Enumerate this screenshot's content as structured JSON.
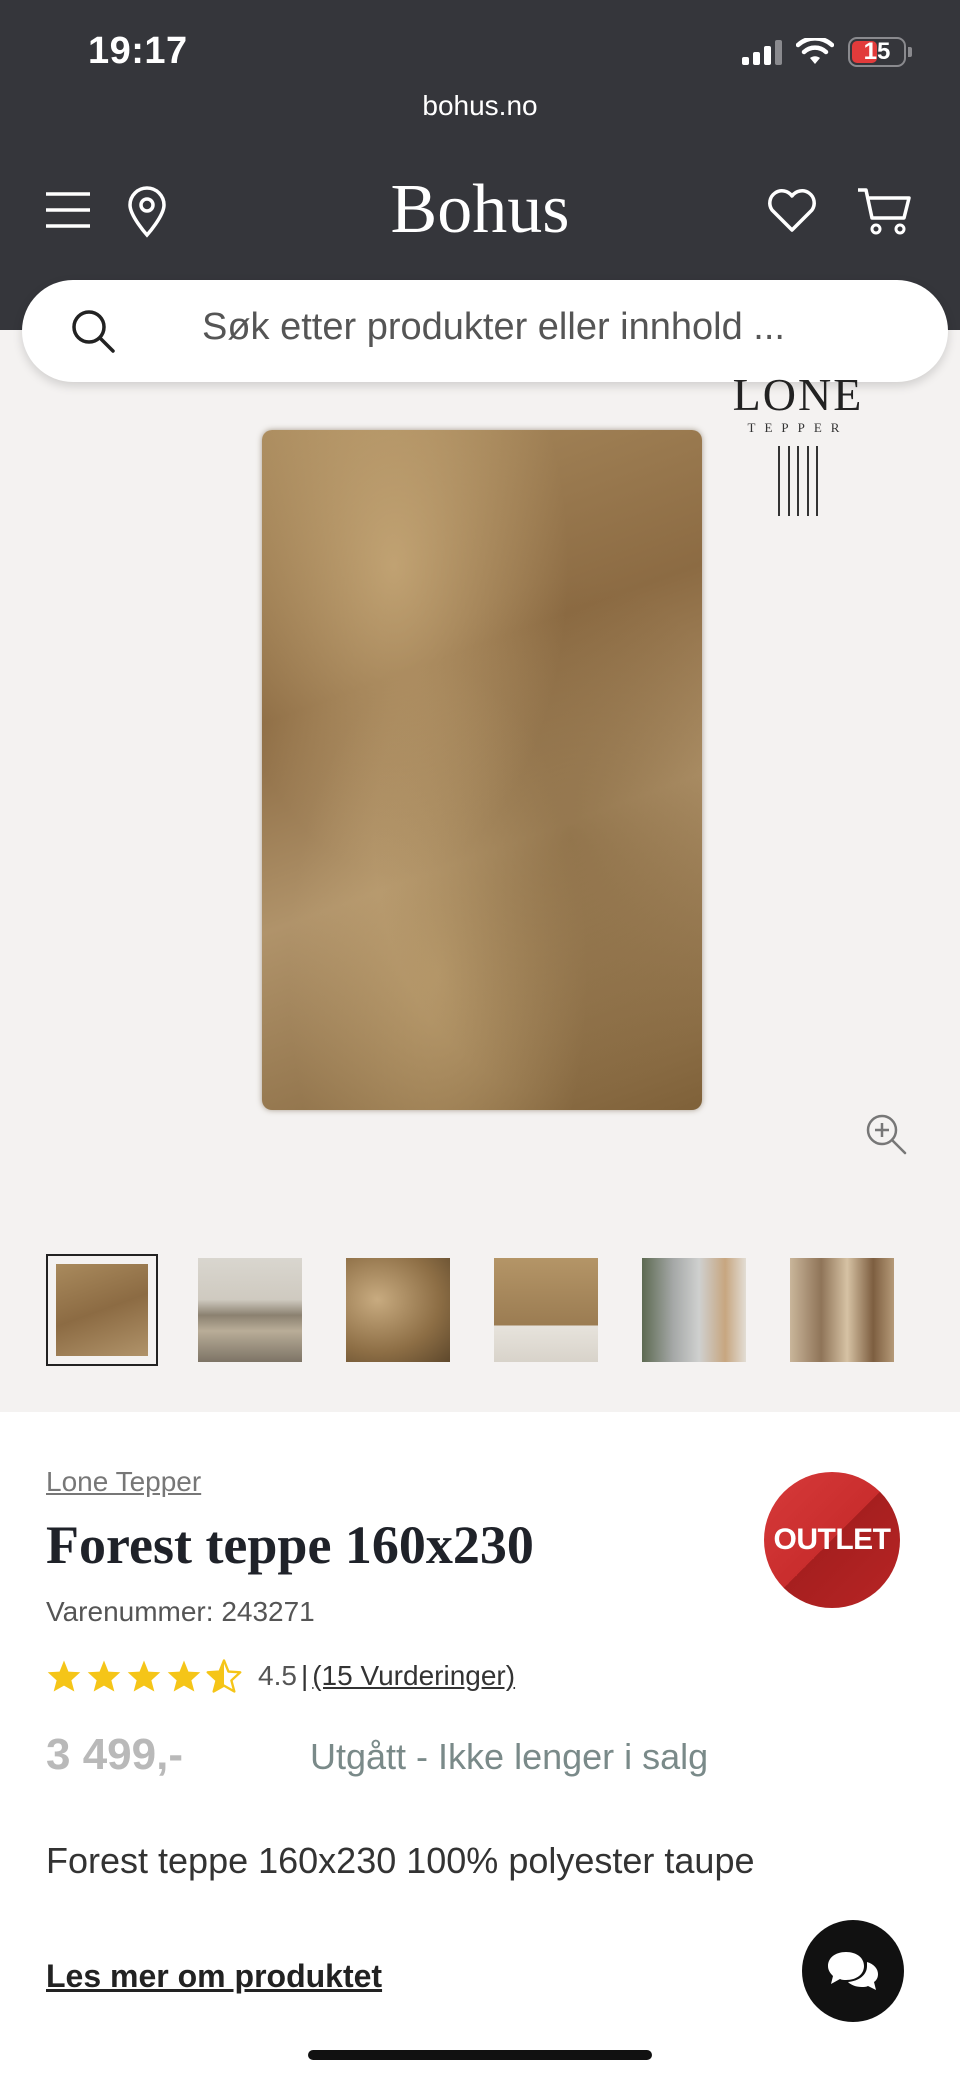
{
  "status_bar": {
    "time": "19:17",
    "battery": "15"
  },
  "browser": {
    "url": "bohus.no"
  },
  "header": {
    "logo": "Bohus"
  },
  "search": {
    "placeholder": "Søk etter produkter eller innhold ..."
  },
  "gallery": {
    "brand_logo": {
      "main": "LONE",
      "sub": "TEPPER"
    },
    "thumbnail_count": 6
  },
  "product": {
    "brand": "Lone Tepper",
    "badge": "OUTLET",
    "title": "Forest teppe 160x230",
    "sku": "Varenummer: 243271",
    "rating": {
      "stars": 4.5,
      "value": "4.5",
      "separator": "|",
      "reviews_link": "(15 Vurderinger)"
    },
    "price": "3 499,-",
    "availability": "Utgått - Ikke lenger i salg",
    "description": "Forest teppe 160x230 100% polyester taupe",
    "read_more": "Les mer om produktet"
  },
  "colors": {
    "header_bg": "#35363b",
    "gallery_bg": "#f4f2f1",
    "star": "#f5c518",
    "outlet_red": "#c92d2d",
    "availability": "#7a8a89"
  }
}
